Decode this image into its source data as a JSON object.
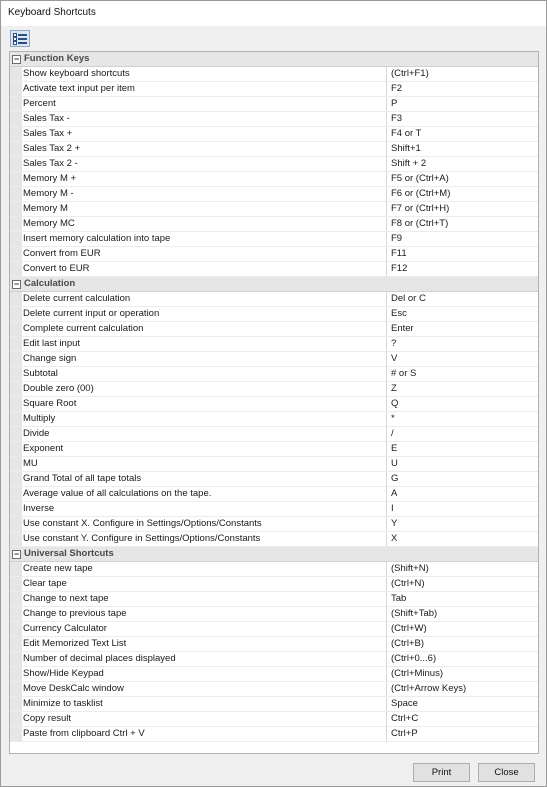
{
  "window": {
    "title": "Keyboard Shortcuts"
  },
  "toolbar": {
    "view_icon": "categorized-list-icon"
  },
  "categories": [
    {
      "label": "Function Keys",
      "collapse_symbol": "−",
      "rows": [
        {
          "name": "Show keyboard shortcuts",
          "key": "(Ctrl+F1)"
        },
        {
          "name": "Activate text input per item",
          "key": "F2"
        },
        {
          "name": "Percent",
          "key": "P"
        },
        {
          "name": "Sales Tax -",
          "key": "F3"
        },
        {
          "name": "Sales Tax +",
          "key": "F4 or T"
        },
        {
          "name": "Sales Tax 2 +",
          "key": "Shift+1"
        },
        {
          "name": "Sales Tax 2 -",
          "key": "Shift + 2"
        },
        {
          "name": "Memory M +",
          "key": "F5 or (Ctrl+A)"
        },
        {
          "name": "Memory M -",
          "key": "F6 or (Ctrl+M)"
        },
        {
          "name": "Memory M",
          "key": "F7 or (Ctrl+H)"
        },
        {
          "name": "Memory MC",
          "key": "F8 or (Ctrl+T)"
        },
        {
          "name": "Insert memory calculation into tape",
          "key": "F9"
        },
        {
          "name": "Convert from EUR",
          "key": "F11"
        },
        {
          "name": "Convert to EUR",
          "key": "F12"
        }
      ]
    },
    {
      "label": "Calculation",
      "collapse_symbol": "−",
      "rows": [
        {
          "name": "Delete current calculation",
          "key": "Del or C"
        },
        {
          "name": "Delete current input or operation",
          "key": "Esc"
        },
        {
          "name": "Complete current calculation",
          "key": "Enter"
        },
        {
          "name": "Edit last input",
          "key": "?"
        },
        {
          "name": "Change sign",
          "key": "V"
        },
        {
          "name": "Subtotal",
          "key": "# or S"
        },
        {
          "name": "Double zero (00)",
          "key": "Z"
        },
        {
          "name": "Square Root",
          "key": "Q"
        },
        {
          "name": "Multiply",
          "key": "*"
        },
        {
          "name": "Divide",
          "key": "/"
        },
        {
          "name": "Exponent",
          "key": "E"
        },
        {
          "name": "MU",
          "key": "U"
        },
        {
          "name": "Grand Total of all tape totals",
          "key": "G"
        },
        {
          "name": "Average value of all calculations on the tape.",
          "key": "A"
        },
        {
          "name": "Inverse",
          "key": "I"
        },
        {
          "name": "Use constant X. Configure in Settings/Options/Constants",
          "key": "Y"
        },
        {
          "name": "Use constant Y. Configure in Settings/Options/Constants",
          "key": "X"
        }
      ]
    },
    {
      "label": "Universal Shortcuts",
      "collapse_symbol": "−",
      "rows": [
        {
          "name": "Create new tape",
          "key": "(Shift+N)"
        },
        {
          "name": "Clear tape",
          "key": "(Ctrl+N)"
        },
        {
          "name": "Change to next tape",
          "key": "Tab"
        },
        {
          "name": "Change to previous tape",
          "key": "(Shift+Tab)"
        },
        {
          "name": "Currency Calculator",
          "key": "(Ctrl+W)"
        },
        {
          "name": "Edit Memorized Text List",
          "key": "(Ctrl+B)"
        },
        {
          "name": "Number of decimal places displayed",
          "key": "(Ctrl+0...6)"
        },
        {
          "name": "Show/Hide Keypad",
          "key": "(Ctrl+Minus)"
        },
        {
          "name": "Move DeskCalc window",
          "key": "(Ctrl+Arrow Keys)"
        },
        {
          "name": "Minimize to tasklist",
          "key": "Space"
        },
        {
          "name": "Copy result",
          "key": "Ctrl+C"
        },
        {
          "name": "Paste from clipboard Ctrl + V",
          "key": "Ctrl+P"
        }
      ]
    }
  ],
  "footer": {
    "print_label": "Print",
    "close_label": "Close"
  }
}
